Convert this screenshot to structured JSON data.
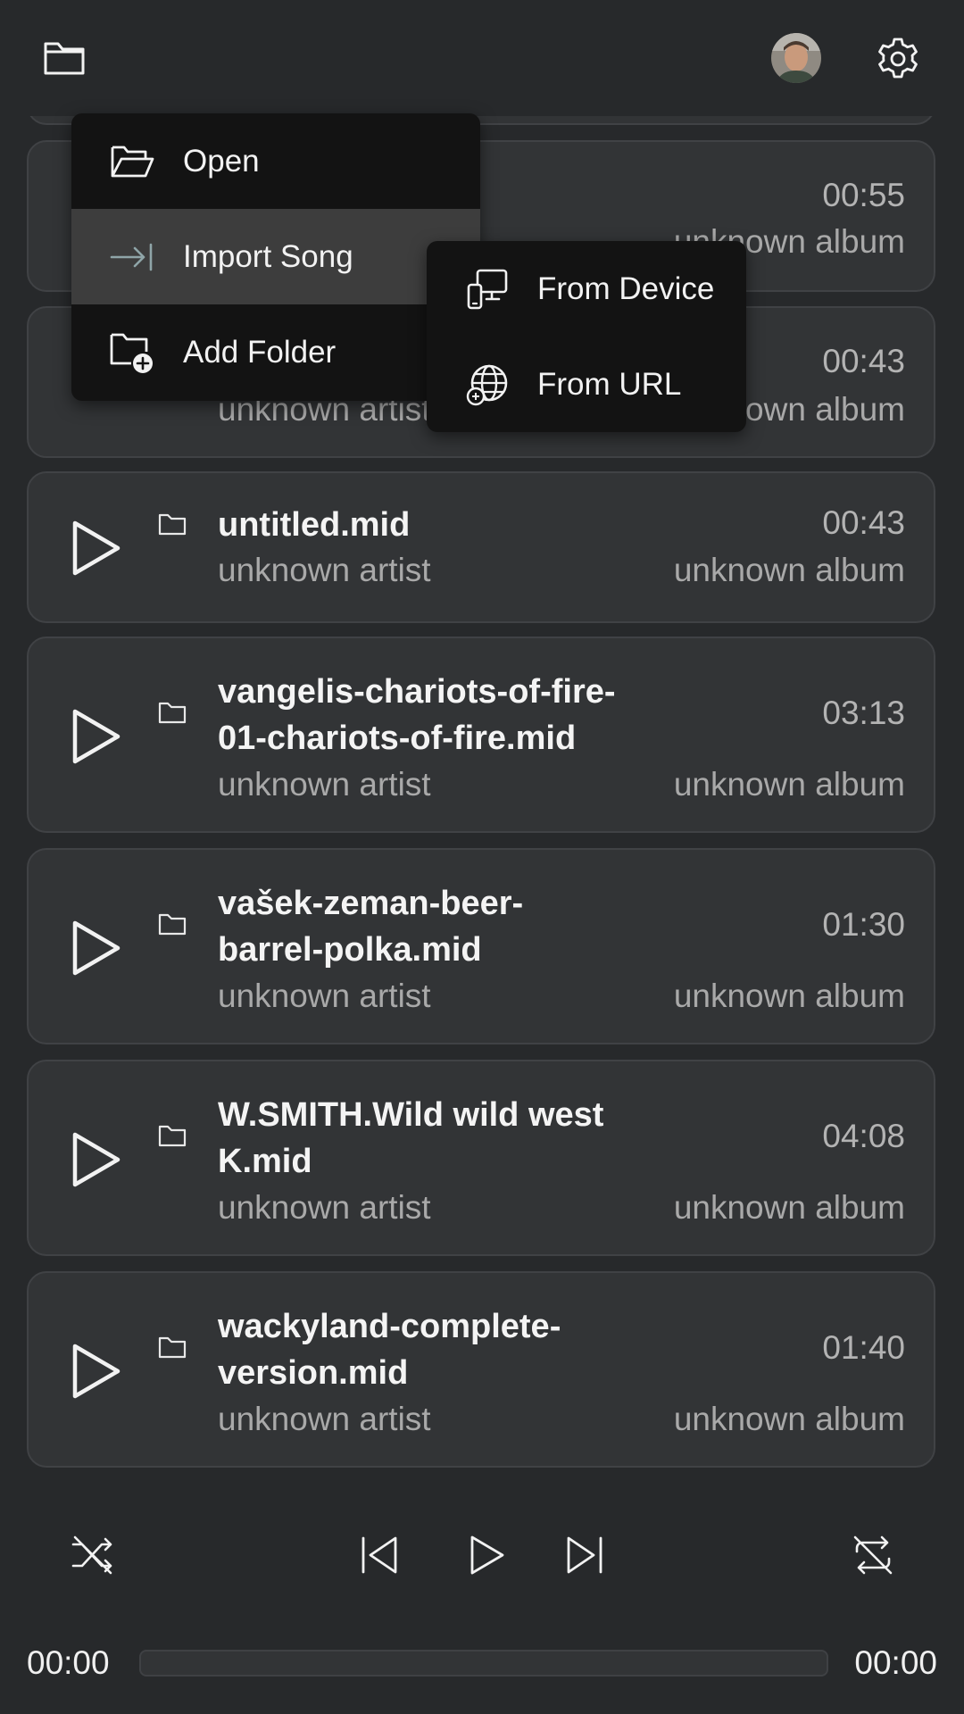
{
  "menu": {
    "items": [
      {
        "label": "Open",
        "icon": "folder-open-icon"
      },
      {
        "label": "Import Song",
        "icon": "import-arrow-icon",
        "active": true
      },
      {
        "label": "Add Folder",
        "icon": "folder-add-icon"
      }
    ],
    "submenu": [
      {
        "label": "From Device",
        "icon": "devices-icon"
      },
      {
        "label": "From URL",
        "icon": "globe-link-icon"
      }
    ]
  },
  "songs": [
    {
      "duration": "00:55",
      "album": "unknown album"
    },
    {
      "artist": "unknown artist",
      "duration": "00:43",
      "album": "unknown album"
    },
    {
      "title": "untitled.mid",
      "artist": "unknown artist",
      "duration": "00:43",
      "album": "unknown album"
    },
    {
      "title": "vangelis-chariots-of-fire-01-chariots-of-fire.mid",
      "title_line1": "vangelis-chariots-of-fire-",
      "title_line2": "01-chariots-of-fire.mid",
      "artist": "unknown artist",
      "duration": "03:13",
      "album": "unknown album"
    },
    {
      "title": "vašek-zeman-beer-barrel-polka.mid",
      "title_line1": "vašek-zeman-beer-",
      "title_line2": "barrel-polka.mid",
      "artist": "unknown artist",
      "duration": "01:30",
      "album": "unknown album"
    },
    {
      "title": "W.SMITH.Wild wild west K.mid",
      "title_line1": "W.SMITH.Wild wild west",
      "title_line2": "K.mid",
      "artist": "unknown artist",
      "duration": "04:08",
      "album": "unknown album"
    },
    {
      "title": "wackyland-complete-version.mid",
      "title_line1": "wackyland-complete-",
      "title_line2": "version.mid",
      "artist": "unknown artist",
      "duration": "01:40",
      "album": "unknown album"
    }
  ],
  "player": {
    "current_time": "00:00",
    "total_time": "00:00",
    "progress": 0
  },
  "colors": {
    "background": "#27292b",
    "card": "#323436",
    "menu": "#131313",
    "menu_active": "#3d3d3d"
  }
}
